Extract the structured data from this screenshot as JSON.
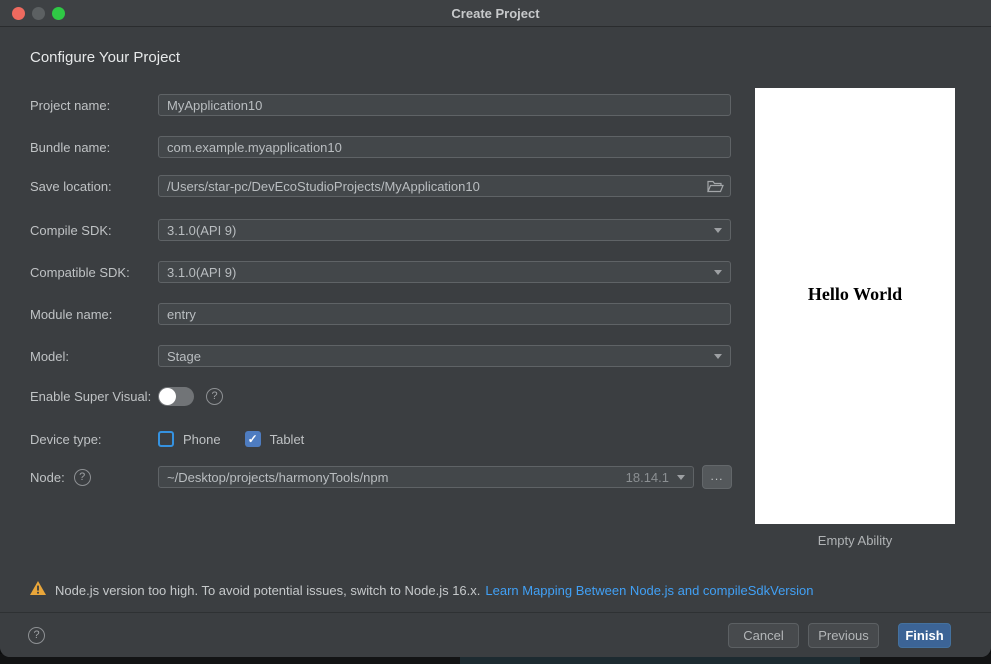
{
  "window": {
    "title": "Create Project"
  },
  "page": {
    "heading": "Configure Your Project"
  },
  "rows": {
    "project_name": {
      "label": "Project name:",
      "value": "MyApplication10"
    },
    "bundle_name": {
      "label": "Bundle name:",
      "value": "com.example.myapplication10"
    },
    "save_location": {
      "label": "Save location:",
      "value": "/Users/star-pc/DevEcoStudioProjects/MyApplication10"
    },
    "compile_sdk": {
      "label": "Compile SDK:",
      "value": "3.1.0(API 9)"
    },
    "compatible_sdk": {
      "label": "Compatible SDK:",
      "value": "3.1.0(API 9)"
    },
    "module_name": {
      "label": "Module name:",
      "value": "entry"
    },
    "model": {
      "label": "Model:",
      "value": "Stage"
    },
    "enable_super_visual": {
      "label": "Enable Super Visual:",
      "enabled": false
    },
    "device_type": {
      "label": "Device type:",
      "phone_label": "Phone",
      "phone_checked": false,
      "tablet_label": "Tablet",
      "tablet_checked": true,
      "check_glyph": "✓"
    },
    "node": {
      "label": "Node:",
      "path": "~/Desktop/projects/harmonyTools/npm",
      "version": "18.14.1",
      "browse_label": "..."
    }
  },
  "preview": {
    "text": "Hello World",
    "caption": "Empty Ability"
  },
  "warning": {
    "text": "Node.js version too high. To avoid potential issues, switch to Node.js 16.x.",
    "link_text": "Learn Mapping Between Node.js and compileSdkVersion"
  },
  "footer": {
    "cancel": "Cancel",
    "previous": "Previous",
    "finish": "Finish",
    "help_glyph": "?"
  },
  "colors": {
    "dialog_bg": "#3b3e41",
    "accent_blue": "#3c6496",
    "link_blue": "#41a0f5",
    "warning_yellow": "#e9a63a",
    "checkbox_border_blue": "#3592e0",
    "checkbox_checked_blue": "#4e7cc0",
    "traffic_red": "#ee6a5f",
    "traffic_green": "#2fc845"
  }
}
